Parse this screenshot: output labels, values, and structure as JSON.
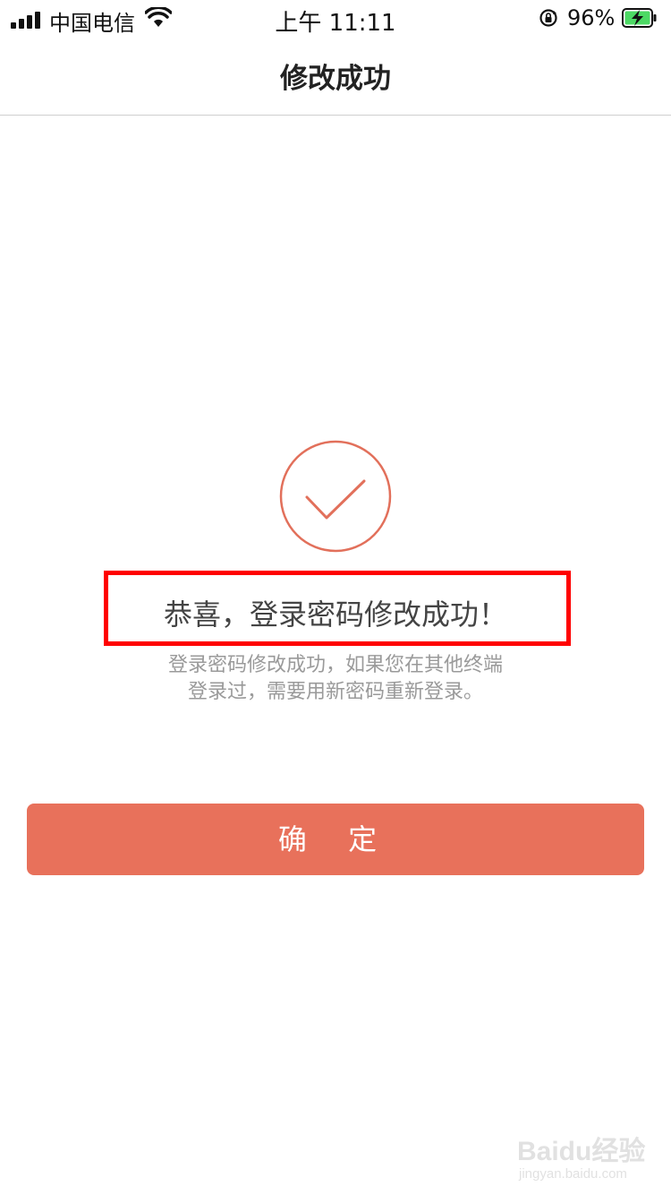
{
  "status_bar": {
    "carrier": "中国电信",
    "time": "上午 11:11",
    "battery_percent": "96%",
    "icons": [
      "signal-icon",
      "wifi-icon",
      "orientation-lock-icon",
      "battery-charging-icon"
    ]
  },
  "nav": {
    "title": "修改成功"
  },
  "success": {
    "icon": "checkmark-circle-icon",
    "title": "恭喜，登录密码修改成功！",
    "desc_line1": "登录密码修改成功，如果您在其他终端",
    "desc_line2": "登录过，需要用新密码重新登录。"
  },
  "actions": {
    "confirm_label": "确 定"
  },
  "watermark": {
    "brand": "Baidu经验",
    "sub": "jingyan.baidu.com"
  },
  "colors": {
    "accent": "#e8715b",
    "highlight": "#ff0000",
    "battery_green": "#4cd964"
  }
}
